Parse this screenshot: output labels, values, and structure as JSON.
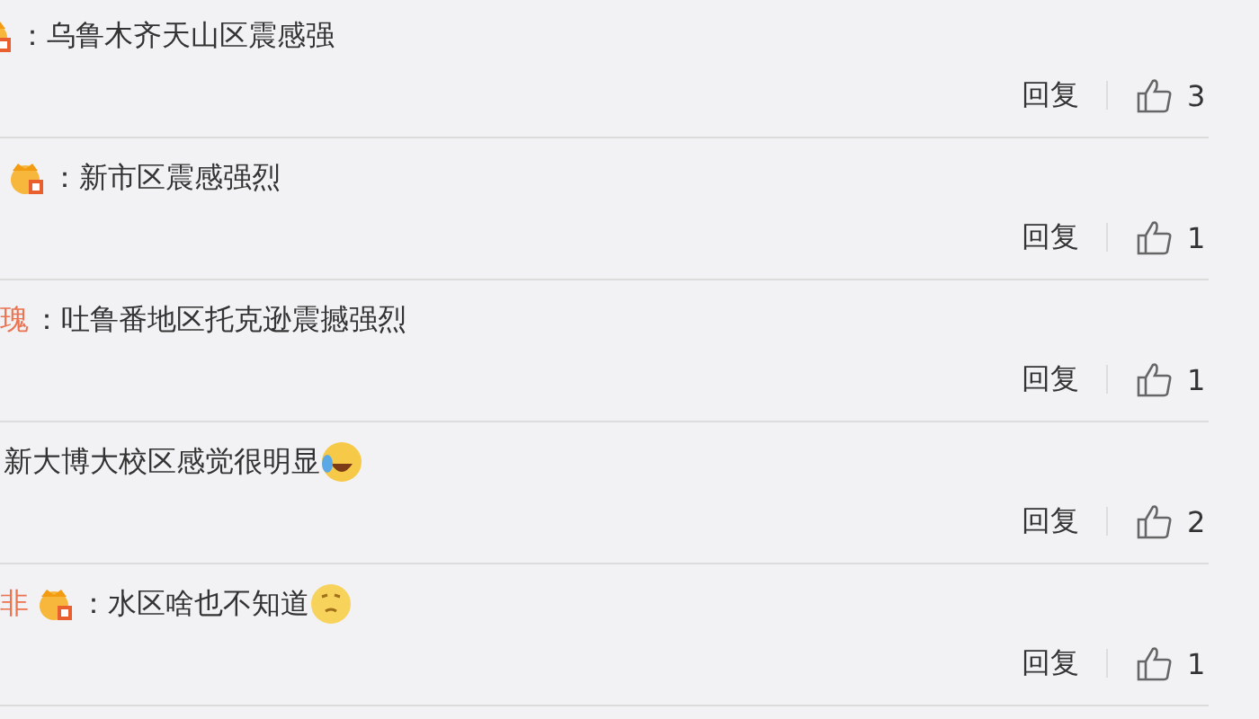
{
  "comments": [
    {
      "badge": {
        "kind": "clipped"
      },
      "text": "：乌鲁木齐天山区震感强",
      "reply": "回复",
      "likes": "3"
    },
    {
      "badge": {
        "kind": "full"
      },
      "text": "：新市区震感强烈",
      "reply": "回复",
      "likes": "1"
    },
    {
      "user": "瑰",
      "text": "：吐鲁番地区托克逊震撼强烈",
      "reply": "回复",
      "likes": "1"
    },
    {
      "text": "新大博大校区感觉很明显",
      "emoji": {
        "kind": "laugh-cry"
      },
      "reply": "回复",
      "likes": "2"
    },
    {
      "user": "非",
      "badge": {
        "kind": "full"
      },
      "text": "：水区啥也不知道",
      "emoji": {
        "kind": "thinking"
      },
      "reply": "回复",
      "likes": "1"
    }
  ]
}
